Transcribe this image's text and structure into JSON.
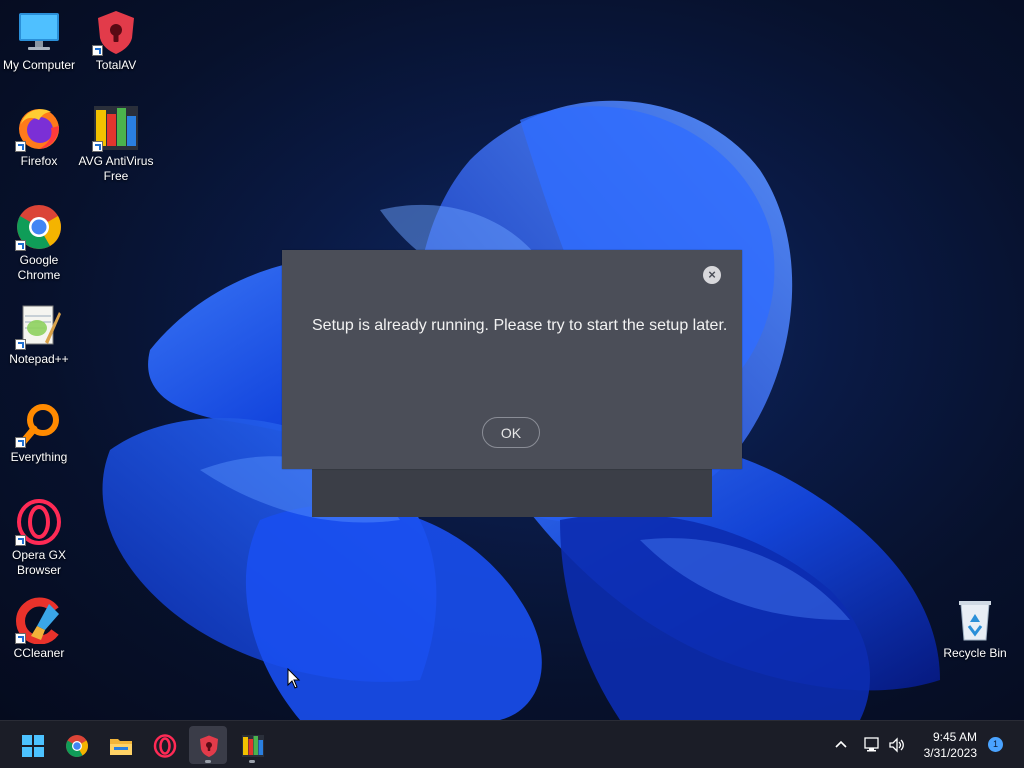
{
  "desktop": {
    "icons": [
      {
        "label": "My Computer",
        "icon": "monitor-icon"
      },
      {
        "label": "TotalAV",
        "icon": "totalav-shield-icon"
      },
      {
        "label": "Firefox",
        "icon": "firefox-icon"
      },
      {
        "label": "AVG AntiVirus",
        "label2": "Free",
        "icon": "avg-icon"
      },
      {
        "label": "Google",
        "label2": "Chrome",
        "icon": "chrome-icon"
      },
      {
        "label": "Notepad++",
        "icon": "notepadpp-icon"
      },
      {
        "label": "Everything",
        "icon": "everything-search-icon"
      },
      {
        "label": "Opera GX",
        "label2": "Browser",
        "icon": "opera-gx-icon"
      },
      {
        "label": "CCleaner",
        "icon": "ccleaner-icon"
      },
      {
        "label": "Recycle Bin",
        "icon": "recycle-bin-icon"
      }
    ]
  },
  "dialog": {
    "message": "Setup is already running. Please try to start the setup later.",
    "close_label": "×",
    "ok_label": "OK"
  },
  "taskbar": {
    "apps": [
      "start-icon",
      "chrome-icon",
      "file-explorer-icon",
      "opera-gx-icon",
      "totalav-shield-icon",
      "avg-icon"
    ],
    "tray": {
      "time": "9:45 AM",
      "date": "3/31/2023",
      "notification_count": "1"
    }
  },
  "colors": {
    "dialog_bg": "#4b4e58",
    "taskbar_bg": "#1b1d27",
    "accent": "#1f6fd0"
  }
}
